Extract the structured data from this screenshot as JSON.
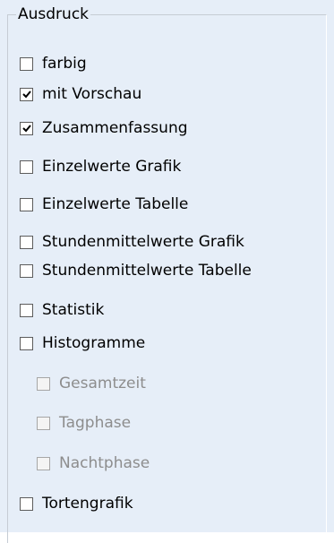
{
  "group": {
    "title": "Ausdruck"
  },
  "checkboxes": [
    {
      "label": "farbig",
      "checked": false,
      "enabled": true
    },
    {
      "label": "mit Vorschau",
      "checked": true,
      "enabled": true
    },
    {
      "label": "Zusammenfassung",
      "checked": true,
      "enabled": true
    },
    {
      "label": "Einzelwerte Grafik",
      "checked": false,
      "enabled": true
    },
    {
      "label": "Einzelwerte Tabelle",
      "checked": false,
      "enabled": true
    },
    {
      "label": "Stundenmittelwerte Grafik",
      "checked": false,
      "enabled": true
    },
    {
      "label": "Stundenmittelwerte Tabelle",
      "checked": false,
      "enabled": true
    },
    {
      "label": "Statistik",
      "checked": false,
      "enabled": true
    },
    {
      "label": "Histogramme",
      "checked": false,
      "enabled": true
    },
    {
      "label": "Gesamtzeit",
      "checked": false,
      "enabled": false
    },
    {
      "label": "Tagphase",
      "checked": false,
      "enabled": false
    },
    {
      "label": "Nachtphase",
      "checked": false,
      "enabled": false
    },
    {
      "label": "Tortengrafik",
      "checked": false,
      "enabled": true
    }
  ],
  "colors": {
    "panel_bg": "#e6eef8",
    "checkbox_border": "#5c5c5c",
    "disabled_text": "#8d8d8d"
  }
}
